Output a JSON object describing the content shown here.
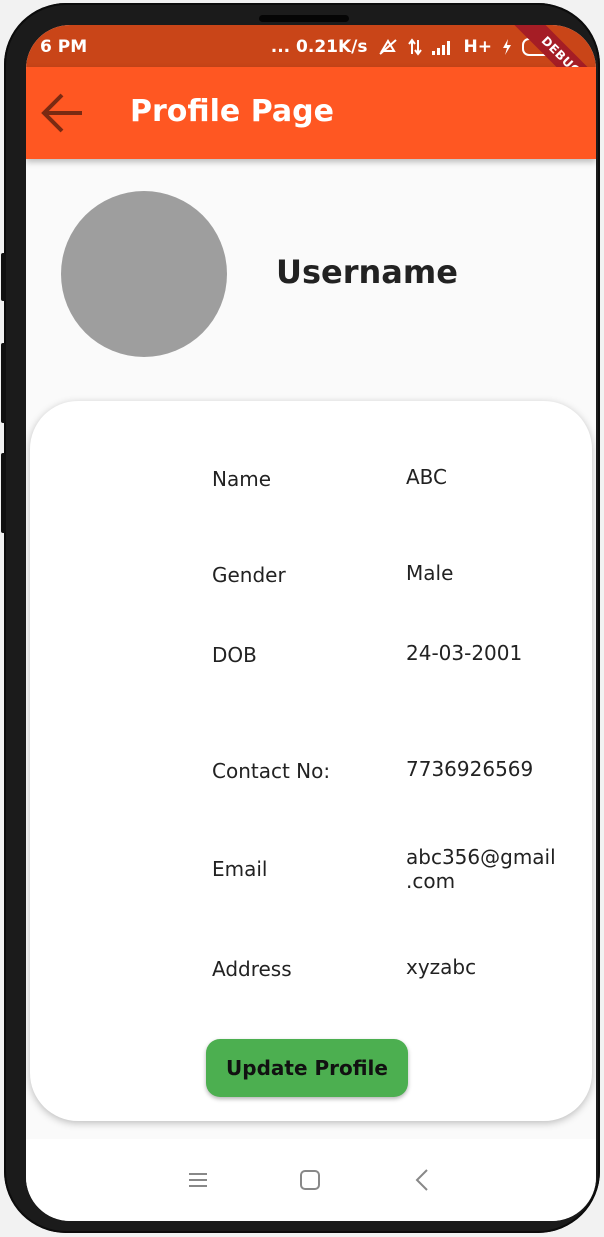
{
  "status_bar": {
    "time": "6 PM",
    "network_speed": "... 0.21K/s",
    "network_type": "H+",
    "debug_label": "DEBUG",
    "bar_color": "#c94518"
  },
  "app_bar": {
    "title": "Profile Page",
    "color": "#ff5722"
  },
  "profile": {
    "username": "Username"
  },
  "details": [
    {
      "label": "Name",
      "value": "ABC"
    },
    {
      "label": "Gender",
      "value": "Male"
    },
    {
      "label": "DOB",
      "value": "24-03-2001"
    },
    {
      "label": "Contact No:",
      "value": "7736926569"
    },
    {
      "label": "Email",
      "value": "abc356@gmail\n.com"
    },
    {
      "label": "Address",
      "value": "xyzabc"
    }
  ],
  "actions": {
    "update_label": "Update Profile",
    "button_color": "#4caf50"
  },
  "nav_bar": {
    "icons": [
      "menu-icon",
      "home-square-icon",
      "back-chevron-icon"
    ]
  }
}
